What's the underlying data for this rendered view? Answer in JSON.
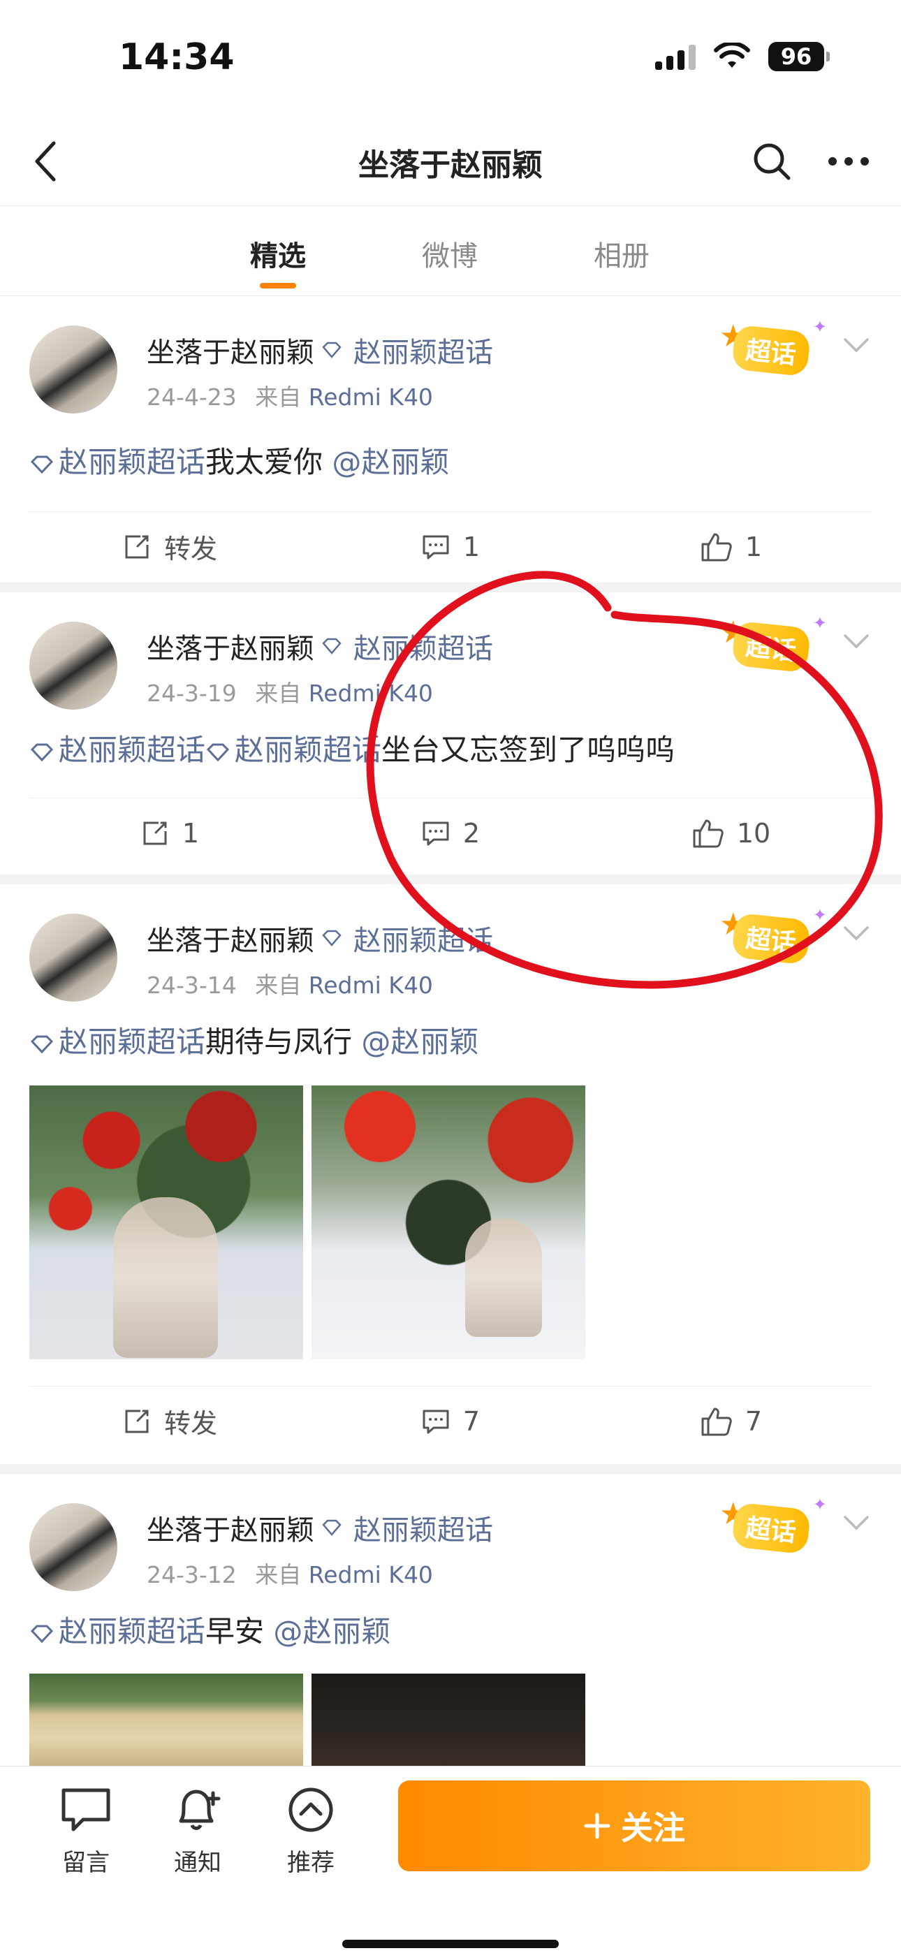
{
  "status_bar": {
    "time": "14:34",
    "battery": "96"
  },
  "nav": {
    "title": "坐落于赵丽颖"
  },
  "tabs": [
    {
      "label": "精选",
      "active": true
    },
    {
      "label": "微博",
      "active": false
    },
    {
      "label": "相册",
      "active": false
    }
  ],
  "posts": [
    {
      "author": "坐落于赵丽颖",
      "topic_tag": "赵丽颖超话",
      "date": "24-4-23",
      "source_prefix": "来自",
      "source": "Redmi K40",
      "badge": "超话",
      "text_topic": "赵丽颖超话",
      "text_body": "我太爱你",
      "text_mention": "@赵丽颖",
      "repost": "转发",
      "comments": "1",
      "likes": "1"
    },
    {
      "author": "坐落于赵丽颖",
      "topic_tag": "赵丽颖超话",
      "date": "24-3-19",
      "source_prefix": "来自",
      "source": "Redmi K40",
      "badge": "超话",
      "text_topic": "赵丽颖超话",
      "text_topic2": "赵丽颖超话",
      "text_body": "坐台又忘签到了呜呜呜",
      "repost": "1",
      "comments": "2",
      "likes": "10"
    },
    {
      "author": "坐落于赵丽颖",
      "topic_tag": "赵丽颖超话",
      "date": "24-3-14",
      "source_prefix": "来自",
      "source": "Redmi K40",
      "badge": "超话",
      "text_topic": "赵丽颖超话",
      "text_body": "期待与凤行",
      "text_mention": "@赵丽颖",
      "repost": "转发",
      "comments": "7",
      "likes": "7"
    },
    {
      "author": "坐落于赵丽颖",
      "topic_tag": "赵丽颖超话",
      "date": "24-3-12",
      "source_prefix": "来自",
      "source": "Redmi K40",
      "badge": "超话",
      "text_topic": "赵丽颖超话",
      "text_body": "早安",
      "text_mention": "@赵丽颖"
    }
  ],
  "bottom_bar": {
    "message": "留言",
    "notify": "通知",
    "recommend": "推荐",
    "follow": "关注"
  },
  "colors": {
    "accent": "#ff8200",
    "topic": "#5b6e97",
    "annotation": "#e0101c"
  }
}
